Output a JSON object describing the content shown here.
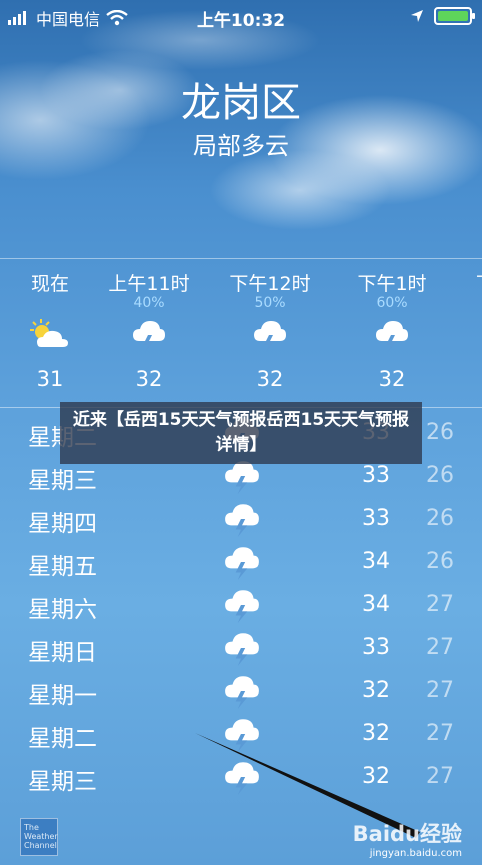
{
  "status": {
    "carrier": "中国电信",
    "time": "上午10:32"
  },
  "location": {
    "city": "龙岗区",
    "condition": "局部多云"
  },
  "hourly": [
    {
      "label": "现在",
      "prob": "",
      "icon": "partly-cloudy-sun-icon",
      "temp": "31"
    },
    {
      "label": "上午11时",
      "prob": "40%",
      "icon": "thunderstorm-icon",
      "temp": "32"
    },
    {
      "label": "下午12时",
      "prob": "50%",
      "icon": "thunderstorm-icon",
      "temp": "32"
    },
    {
      "label": "下午1时",
      "prob": "60%",
      "icon": "thunderstorm-icon",
      "temp": "32"
    }
  ],
  "daily": [
    {
      "day": "星期二",
      "icon": "thunderstorm-icon",
      "high": "33",
      "low": "26"
    },
    {
      "day": "星期三",
      "icon": "thunderstorm-icon",
      "high": "33",
      "low": "26"
    },
    {
      "day": "星期四",
      "icon": "thunderstorm-icon",
      "high": "33",
      "low": "26"
    },
    {
      "day": "星期五",
      "icon": "thunderstorm-icon",
      "high": "34",
      "low": "26"
    },
    {
      "day": "星期六",
      "icon": "thunderstorm-icon",
      "high": "34",
      "low": "27"
    },
    {
      "day": "星期日",
      "icon": "thunderstorm-icon",
      "high": "33",
      "low": "27"
    },
    {
      "day": "星期一",
      "icon": "thunderstorm-icon",
      "high": "32",
      "low": "27"
    },
    {
      "day": "星期二",
      "icon": "thunderstorm-icon",
      "high": "32",
      "low": "27"
    },
    {
      "day": "星期三",
      "icon": "thunderstorm-icon",
      "high": "32",
      "low": "27"
    }
  ],
  "overlay_title": "近来【岳西15天天气预报岳西15天天气预报详情】",
  "footer": {
    "weather_channel_logo": "The Weather Channel",
    "watermark": "Baidu经验",
    "watermark_url": "jingyan.baidu.com"
  },
  "colors": {
    "battery": "#5ed55b",
    "precip": "#a9dbff"
  }
}
